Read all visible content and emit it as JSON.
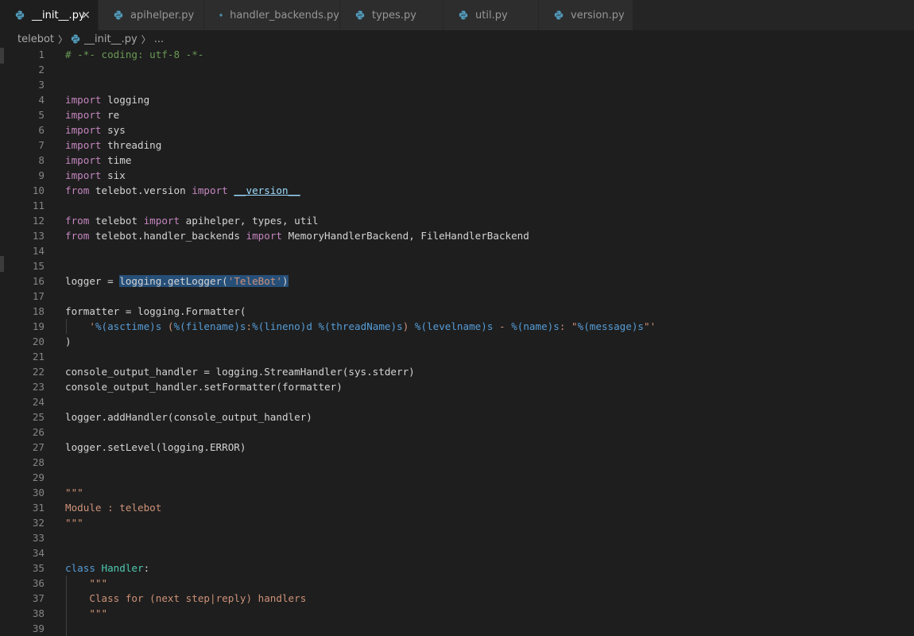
{
  "tabs": [
    {
      "label": "__init__.py",
      "active": true,
      "close": "×"
    },
    {
      "label": "apihelper.py",
      "active": false
    },
    {
      "label": "handler_backends.py",
      "active": false
    },
    {
      "label": "types.py",
      "active": false
    },
    {
      "label": "util.py",
      "active": false
    },
    {
      "label": "version.py",
      "active": false
    }
  ],
  "breadcrumb": {
    "folder": "telebot",
    "file": "__init__.py",
    "symbol": "..."
  },
  "colors": {
    "python_icon": "#519aba",
    "keyword": "#c586c0",
    "keyword_blue": "#569cd6",
    "comment": "#6a9955",
    "string": "#ce9178",
    "class_name": "#4ec9b0",
    "selection": "#264f78"
  },
  "editor": {
    "lines": [
      {
        "n": "1",
        "tokens": [
          [
            "comment",
            "# -*- coding: utf-8 -*-"
          ]
        ]
      },
      {
        "n": "2",
        "tokens": []
      },
      {
        "n": "3",
        "tokens": []
      },
      {
        "n": "4",
        "tokens": [
          [
            "kw",
            "import"
          ],
          [
            "plain",
            " logging"
          ]
        ]
      },
      {
        "n": "5",
        "tokens": [
          [
            "kw",
            "import"
          ],
          [
            "plain",
            " re"
          ]
        ]
      },
      {
        "n": "6",
        "tokens": [
          [
            "kw",
            "import"
          ],
          [
            "plain",
            " sys"
          ]
        ]
      },
      {
        "n": "7",
        "tokens": [
          [
            "kw",
            "import"
          ],
          [
            "plain",
            " threading"
          ]
        ]
      },
      {
        "n": "8",
        "tokens": [
          [
            "kw",
            "import"
          ],
          [
            "plain",
            " time"
          ]
        ]
      },
      {
        "n": "9",
        "tokens": [
          [
            "kw",
            "import"
          ],
          [
            "plain",
            " six"
          ]
        ]
      },
      {
        "n": "10",
        "tokens": [
          [
            "kw",
            "from"
          ],
          [
            "plain",
            " telebot.version "
          ],
          [
            "kw",
            "import"
          ],
          [
            "plain",
            " "
          ],
          [
            "dunder",
            "__version__"
          ]
        ]
      },
      {
        "n": "11",
        "tokens": []
      },
      {
        "n": "12",
        "tokens": [
          [
            "kw",
            "from"
          ],
          [
            "plain",
            " telebot "
          ],
          [
            "kw",
            "import"
          ],
          [
            "plain",
            " apihelper, types, util"
          ]
        ]
      },
      {
        "n": "13",
        "tokens": [
          [
            "kw",
            "from"
          ],
          [
            "plain",
            " telebot.handler_backends "
          ],
          [
            "kw",
            "import"
          ],
          [
            "plain",
            " MemoryHandlerBackend, FileHandlerBackend"
          ]
        ]
      },
      {
        "n": "14",
        "tokens": []
      },
      {
        "n": "15",
        "tokens": []
      },
      {
        "n": "16",
        "tokens": [
          [
            "plain",
            "logger = "
          ],
          [
            "sel_plain",
            "logging.getLogger("
          ],
          [
            "sel_str",
            "'TeleBot'"
          ],
          [
            "sel_plain",
            ")"
          ]
        ]
      },
      {
        "n": "17",
        "tokens": []
      },
      {
        "n": "18",
        "tokens": [
          [
            "plain",
            "formatter = logging.Formatter("
          ]
        ]
      },
      {
        "n": "19",
        "tokens": [
          [
            "plain",
            "    "
          ],
          [
            "str",
            "'"
          ],
          [
            "fmt",
            "%(asctime)s"
          ],
          [
            "str",
            " ("
          ],
          [
            "fmt",
            "%(filename)s"
          ],
          [
            "str",
            ":"
          ],
          [
            "fmt",
            "%(lineno)d"
          ],
          [
            "str",
            " "
          ],
          [
            "fmt",
            "%(threadName)s"
          ],
          [
            "str",
            ") "
          ],
          [
            "fmt",
            "%(levelname)s"
          ],
          [
            "str",
            " - "
          ],
          [
            "fmt",
            "%(name)s"
          ],
          [
            "str",
            ": \""
          ],
          [
            "fmt",
            "%(message)s"
          ],
          [
            "str",
            "\"'"
          ]
        ]
      },
      {
        "n": "20",
        "tokens": [
          [
            "plain",
            ")"
          ]
        ]
      },
      {
        "n": "21",
        "tokens": []
      },
      {
        "n": "22",
        "tokens": [
          [
            "plain",
            "console_output_handler = logging.StreamHandler(sys.stderr)"
          ]
        ]
      },
      {
        "n": "23",
        "tokens": [
          [
            "plain",
            "console_output_handler.setFormatter(formatter)"
          ]
        ]
      },
      {
        "n": "24",
        "tokens": []
      },
      {
        "n": "25",
        "tokens": [
          [
            "plain",
            "logger.addHandler(console_output_handler)"
          ]
        ]
      },
      {
        "n": "26",
        "tokens": []
      },
      {
        "n": "27",
        "tokens": [
          [
            "plain",
            "logger.setLevel(logging.ERROR)"
          ]
        ]
      },
      {
        "n": "28",
        "tokens": []
      },
      {
        "n": "29",
        "tokens": []
      },
      {
        "n": "30",
        "tokens": [
          [
            "str",
            "\"\"\""
          ]
        ]
      },
      {
        "n": "31",
        "tokens": [
          [
            "str",
            "Module : telebot"
          ]
        ]
      },
      {
        "n": "32",
        "tokens": [
          [
            "str",
            "\"\"\""
          ]
        ]
      },
      {
        "n": "33",
        "tokens": []
      },
      {
        "n": "34",
        "tokens": []
      },
      {
        "n": "35",
        "tokens": [
          [
            "kwb",
            "class"
          ],
          [
            "plain",
            " "
          ],
          [
            "cls",
            "Handler"
          ],
          [
            "plain",
            ":"
          ]
        ]
      },
      {
        "n": "36",
        "tokens": [
          [
            "plain",
            "    "
          ],
          [
            "str",
            "\"\"\""
          ]
        ]
      },
      {
        "n": "37",
        "tokens": [
          [
            "plain",
            "    "
          ],
          [
            "str",
            "Class for (next step|reply) handlers"
          ]
        ]
      },
      {
        "n": "38",
        "tokens": [
          [
            "plain",
            "    "
          ],
          [
            "str",
            "\"\"\""
          ]
        ]
      },
      {
        "n": "39",
        "tokens": []
      }
    ]
  }
}
